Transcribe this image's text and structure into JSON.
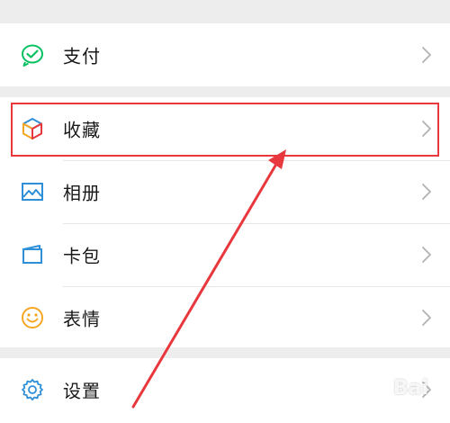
{
  "menu": {
    "pay": {
      "label": "支付"
    },
    "favorites": {
      "label": "收藏"
    },
    "album": {
      "label": "相册"
    },
    "cards": {
      "label": "卡包"
    },
    "stickers": {
      "label": "表情"
    },
    "settings": {
      "label": "设置"
    }
  },
  "colors": {
    "background": "#ededed",
    "row": "#ffffff",
    "text": "#191919",
    "chevron": "#b2b2b2",
    "annotation": "#e8373d",
    "pay_icon": "#07c160",
    "blue_icon": "#2f8fd8",
    "sticker_icon": "#f5a623"
  },
  "watermark": {
    "text": "Bai"
  }
}
